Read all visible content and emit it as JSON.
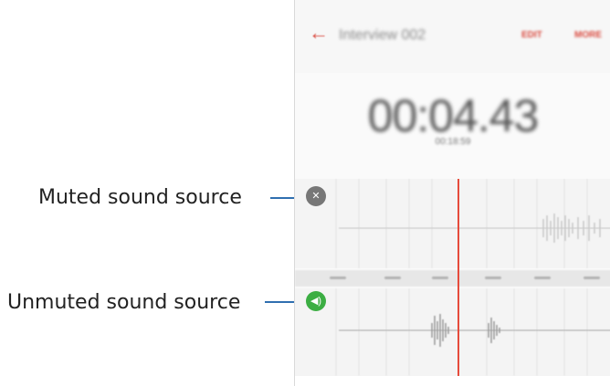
{
  "callouts": {
    "muted_label": "Muted sound source",
    "unmuted_label": "Unmuted sound source"
  },
  "app": {
    "title": "Interview 002",
    "actions": {
      "edit": "EDIT",
      "more": "MORE"
    },
    "timer": "00:04.43",
    "timer_sub": "00:18:59"
  },
  "icons": {
    "back": "arrow-left-icon",
    "muted": "speaker-muted-icon",
    "unmuted": "speaker-on-icon"
  },
  "colors": {
    "accent": "#d94a3f",
    "callout_line": "#2f6fb0",
    "muted_icon": "#777777",
    "unmuted_icon": "#3cae43",
    "playhead": "#e64b3c"
  }
}
